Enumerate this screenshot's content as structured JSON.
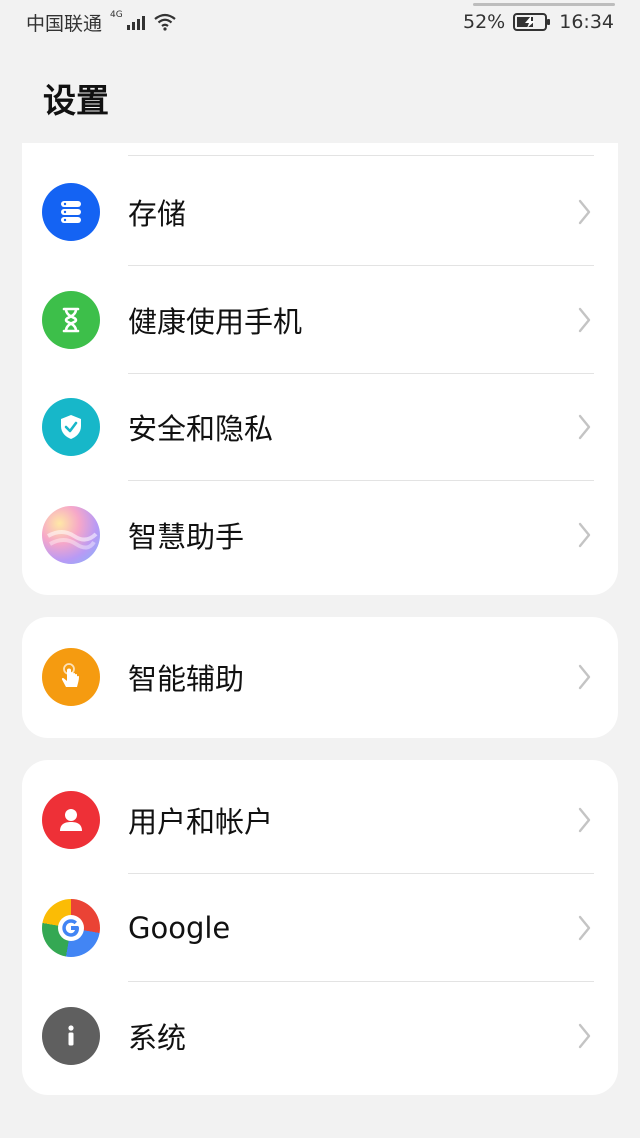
{
  "status_bar": {
    "carrier": "中国联通",
    "network": "4G",
    "battery_pct": "52%",
    "time": "16:34"
  },
  "page": {
    "title": "设置"
  },
  "groups": [
    {
      "items": [
        {
          "label": "存储",
          "icon": "storage-icon",
          "color": "#1463f3"
        },
        {
          "label": "健康使用手机",
          "icon": "hourglass-icon",
          "color": "#3dbf4a"
        },
        {
          "label": "安全和隐私",
          "icon": "shield-check-icon",
          "color": "#17b7c9"
        },
        {
          "label": "智慧助手",
          "icon": "assistant-gradient-icon",
          "color": "#e78bd0"
        }
      ]
    },
    {
      "items": [
        {
          "label": "智能辅助",
          "icon": "hand-tap-icon",
          "color": "#f59b10"
        }
      ]
    },
    {
      "items": [
        {
          "label": "用户和帐户",
          "icon": "user-icon",
          "color": "#ee3037"
        },
        {
          "label": "Google",
          "icon": "google-icon",
          "color": "#4285f4"
        },
        {
          "label": "系统",
          "icon": "info-icon",
          "color": "#5f5f5f"
        }
      ]
    }
  ]
}
